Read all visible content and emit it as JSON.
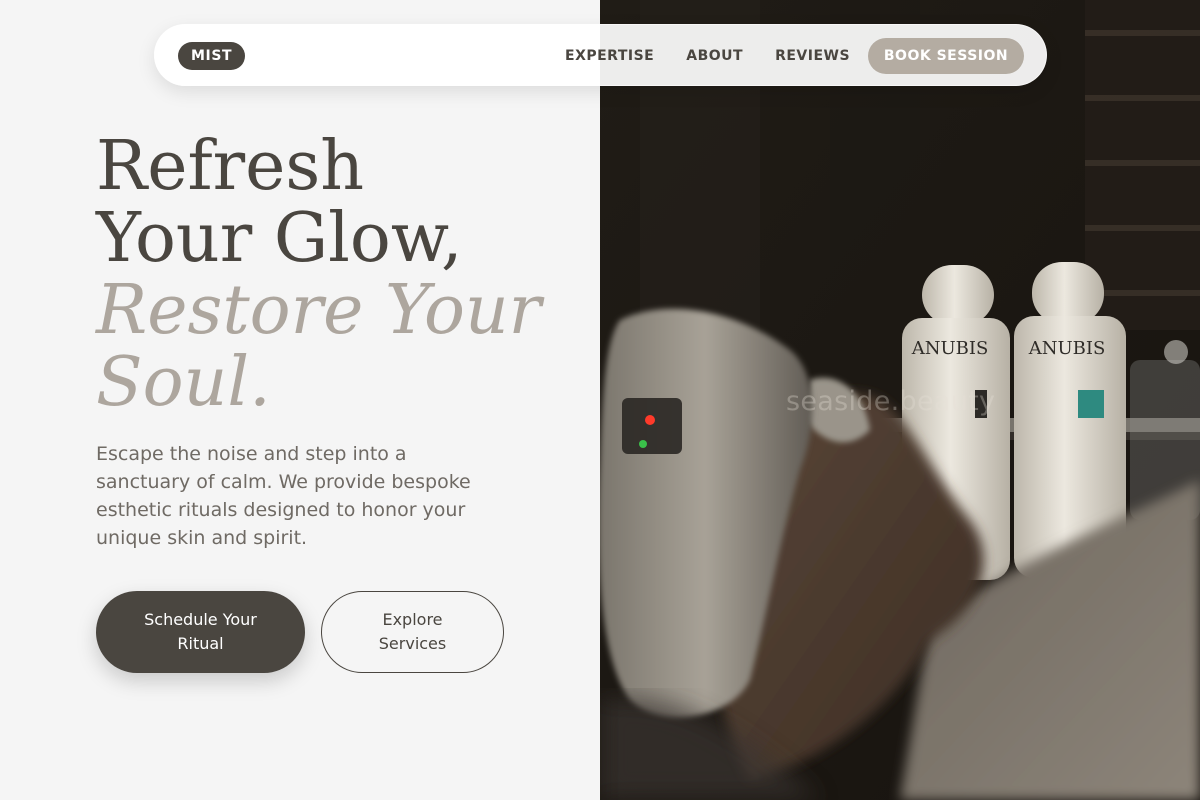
{
  "nav": {
    "logo": "MIST",
    "links": [
      "EXPERTISE",
      "ABOUT",
      "REVIEWS"
    ],
    "cta": "BOOK SESSION"
  },
  "hero": {
    "title_line1": "Refresh",
    "title_line2": "Your Glow,",
    "title_line3": "Restore Your",
    "title_line4": "Soul.",
    "description": "Escape the noise and step into a sanctuary of calm. We provide bespoke esthetic rituals designed to honor your unique skin and spirit.",
    "primary_button": "Schedule Your Ritual",
    "secondary_button": "Explore Services"
  },
  "image": {
    "bottle_brand": "ANUBIS",
    "watermark": "seaside.beauty"
  },
  "colors": {
    "dark": "#4a4640",
    "accent": "#b4aca2",
    "muted": "#ada69e",
    "background": "#f5f5f5"
  }
}
